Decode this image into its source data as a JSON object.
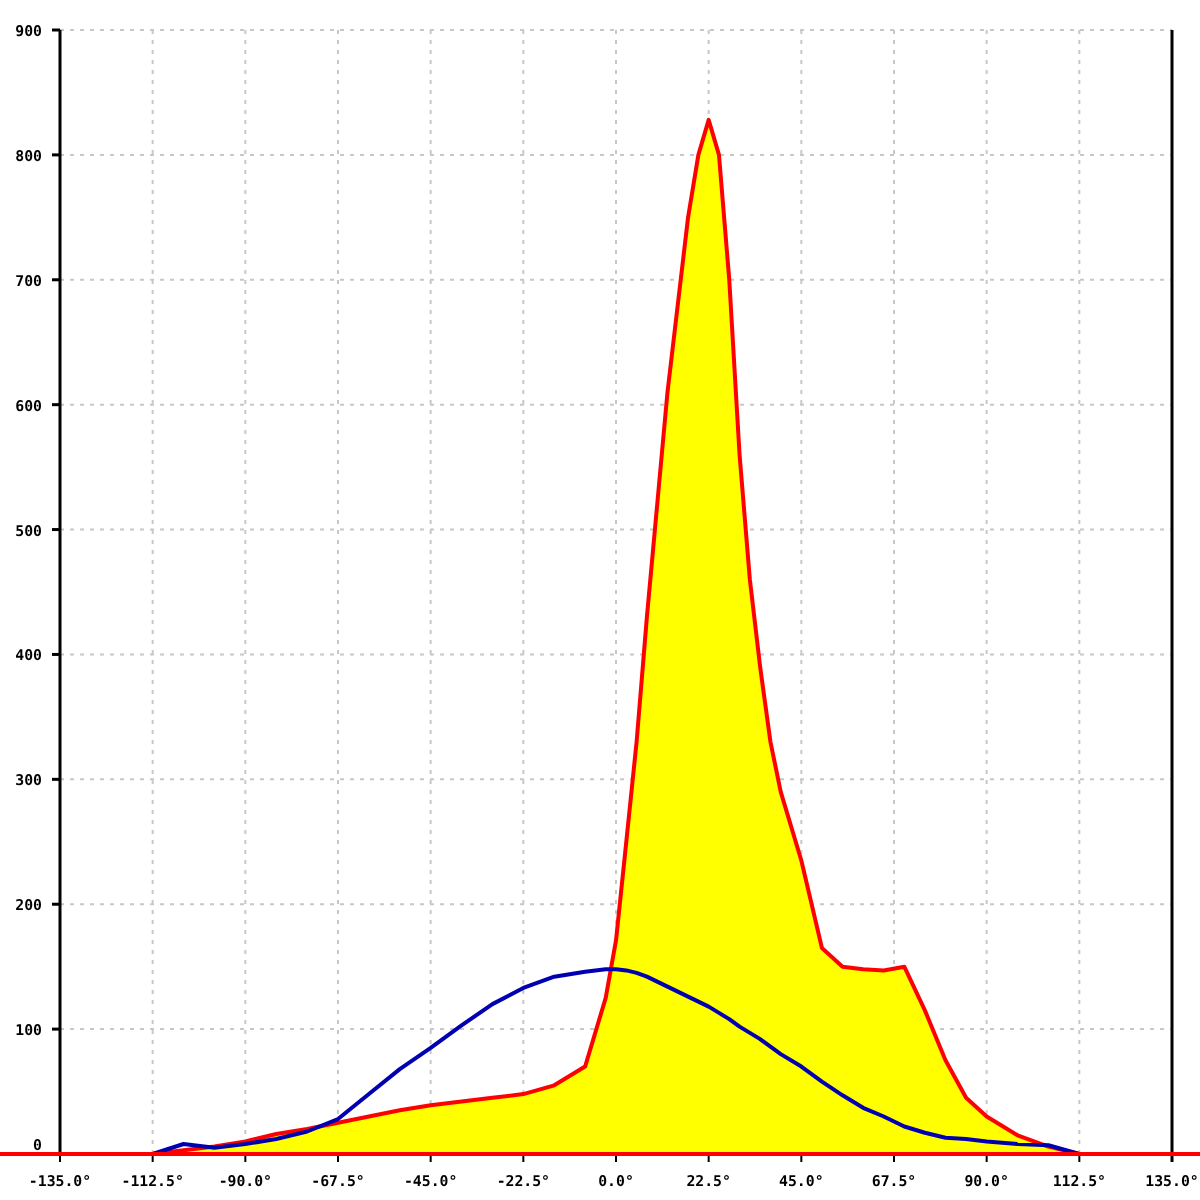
{
  "chart_data": {
    "type": "area",
    "x": [
      -112.5,
      -105,
      -97.5,
      -90,
      -82.5,
      -75,
      -67.5,
      -60,
      -52.5,
      -45,
      -37.5,
      -30,
      -22.5,
      -15,
      -7.5,
      -2.5,
      0,
      2.5,
      5,
      7.5,
      10,
      12.5,
      15,
      17.5,
      20,
      22.5,
      25,
      27.5,
      30,
      32.5,
      35,
      37.5,
      40,
      45,
      50,
      55,
      60,
      65,
      70,
      75,
      80,
      85,
      90,
      97.5,
      105,
      112.5
    ],
    "series": [
      {
        "type": "area",
        "color": "#ff0000",
        "values": [
          0,
          3,
          6,
          10,
          16,
          20,
          25,
          30,
          35,
          39,
          42,
          45,
          48,
          55,
          70,
          125,
          171,
          250,
          330,
          430,
          520,
          610,
          680,
          750,
          800,
          828,
          800,
          700,
          560,
          460,
          390,
          330,
          290,
          235,
          165,
          150,
          148,
          147,
          150,
          115,
          75,
          45,
          30,
          15,
          6,
          0
        ]
      },
      {
        "type": "line",
        "color": "#0000b0",
        "values": [
          0,
          8,
          5,
          8,
          12,
          18,
          28,
          48,
          68,
          85,
          103,
          120,
          133,
          142,
          146,
          148,
          148,
          147,
          145,
          142,
          138,
          134,
          130,
          126,
          122,
          118,
          113,
          108,
          102,
          97,
          92,
          86,
          80,
          70,
          58,
          47,
          37,
          30,
          22,
          17,
          13,
          12,
          10,
          8,
          7,
          0
        ]
      }
    ],
    "xlim": [
      -135,
      135
    ],
    "ylim": [
      0,
      900
    ],
    "xticks": [
      {
        "value": -135,
        "label": "-135.0°"
      },
      {
        "value": -112.5,
        "label": "-112.5°"
      },
      {
        "value": -90,
        "label": "-90.0°"
      },
      {
        "value": -67.5,
        "label": "-67.5°"
      },
      {
        "value": -45,
        "label": "-45.0°"
      },
      {
        "value": -22.5,
        "label": "-22.5°"
      },
      {
        "value": 0,
        "label": "0.0°"
      },
      {
        "value": 22.5,
        "label": "22.5°"
      },
      {
        "value": 45,
        "label": "45.0°"
      },
      {
        "value": 67.5,
        "label": "67.5°"
      },
      {
        "value": 90,
        "label": "90.0°"
      },
      {
        "value": 112.5,
        "label": "112.5°"
      },
      {
        "value": 135,
        "label": "135.0°"
      }
    ],
    "yticks": [
      0,
      100,
      200,
      300,
      400,
      500,
      600,
      700,
      800,
      900
    ],
    "grid": true
  }
}
